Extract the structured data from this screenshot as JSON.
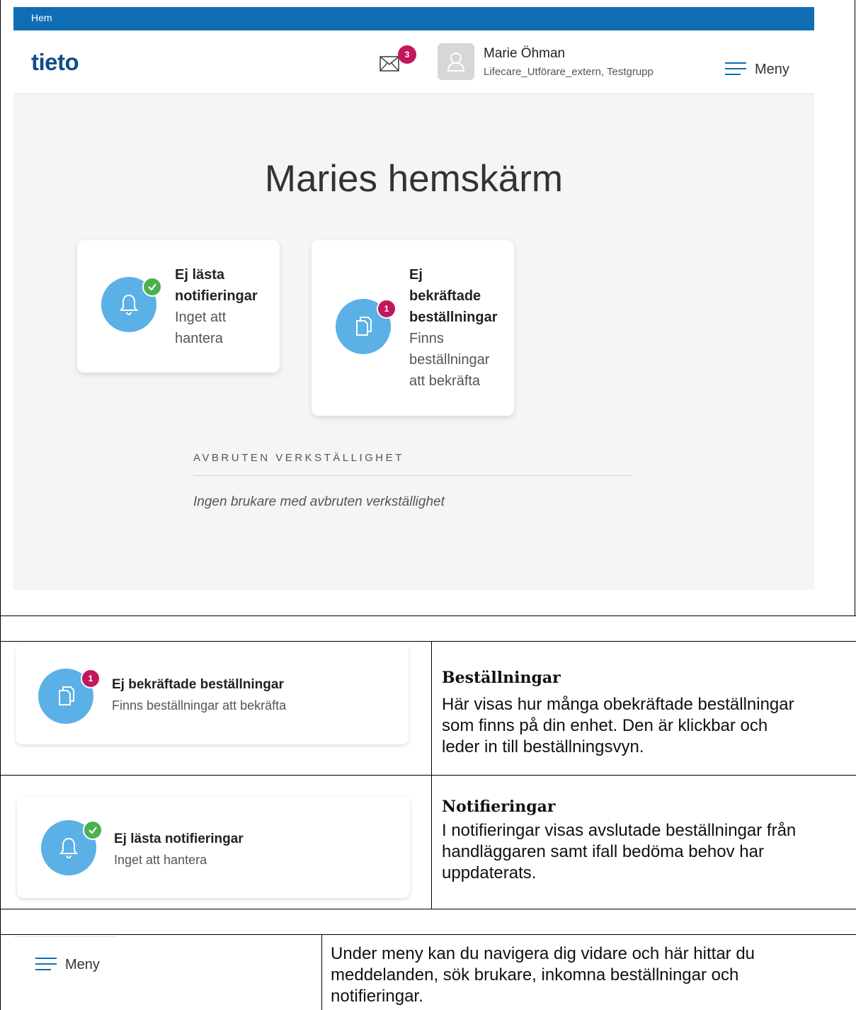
{
  "screenshot": {
    "breadcrumb": "Hem",
    "logo": "tieto",
    "mail_count": "3",
    "user": {
      "name": "Marie Öhman",
      "role": "Lifecare_Utförare_extern, Testgrupp"
    },
    "menu_label": "Meny",
    "page_title": "Maries hemskärm",
    "cards": [
      {
        "title_lines": [
          "Ej lästa",
          "notifieringar"
        ],
        "sub_lines": [
          "Inget att",
          "hantera"
        ],
        "icon": "bell-icon",
        "badge": "check"
      },
      {
        "title_lines": [
          "Ej",
          "bekräftade",
          "beställningar"
        ],
        "sub_lines": [
          "Finns",
          "beställningar",
          "att bekräfta"
        ],
        "icon": "documents-icon",
        "badge": "1"
      }
    ],
    "section": {
      "label": "AVBRUTEN VERKSTÄLLIGHET",
      "empty_text": "Ingen brukare med avbruten verkställighet"
    }
  },
  "table": {
    "rows": [
      {
        "card_title": "Ej bekräftade beställningar",
        "card_sub": "Finns beställningar att bekräfta",
        "card_badge": "1",
        "desc_title": "Beställningar",
        "desc_lines": [
          "Här visas hur många obekräftade beställningar",
          "som finns på din enhet. Den är klickbar och",
          "leder in till beställningsvyn."
        ]
      },
      {
        "card_title": "Ej lästa notifieringar",
        "card_sub": "Inget att hantera",
        "desc_title": "Notifieringar",
        "desc_lines": [
          "I notifieringar visas avslutade beställningar från",
          "handläggaren samt ifall bedöma behov har",
          "uppdaterats."
        ]
      }
    ],
    "menu_row": {
      "menu_label": "Meny",
      "desc_lines": [
        "Under meny kan du navigera dig vidare och här hittar du",
        "meddelanden, sök brukare, inkomna beställningar och",
        "notifieringar."
      ]
    }
  },
  "colors": {
    "brand_blue": "#0f6eb3",
    "icon_blue": "#5bb0e6",
    "badge_red": "#c2185b",
    "badge_green": "#4caf50"
  }
}
